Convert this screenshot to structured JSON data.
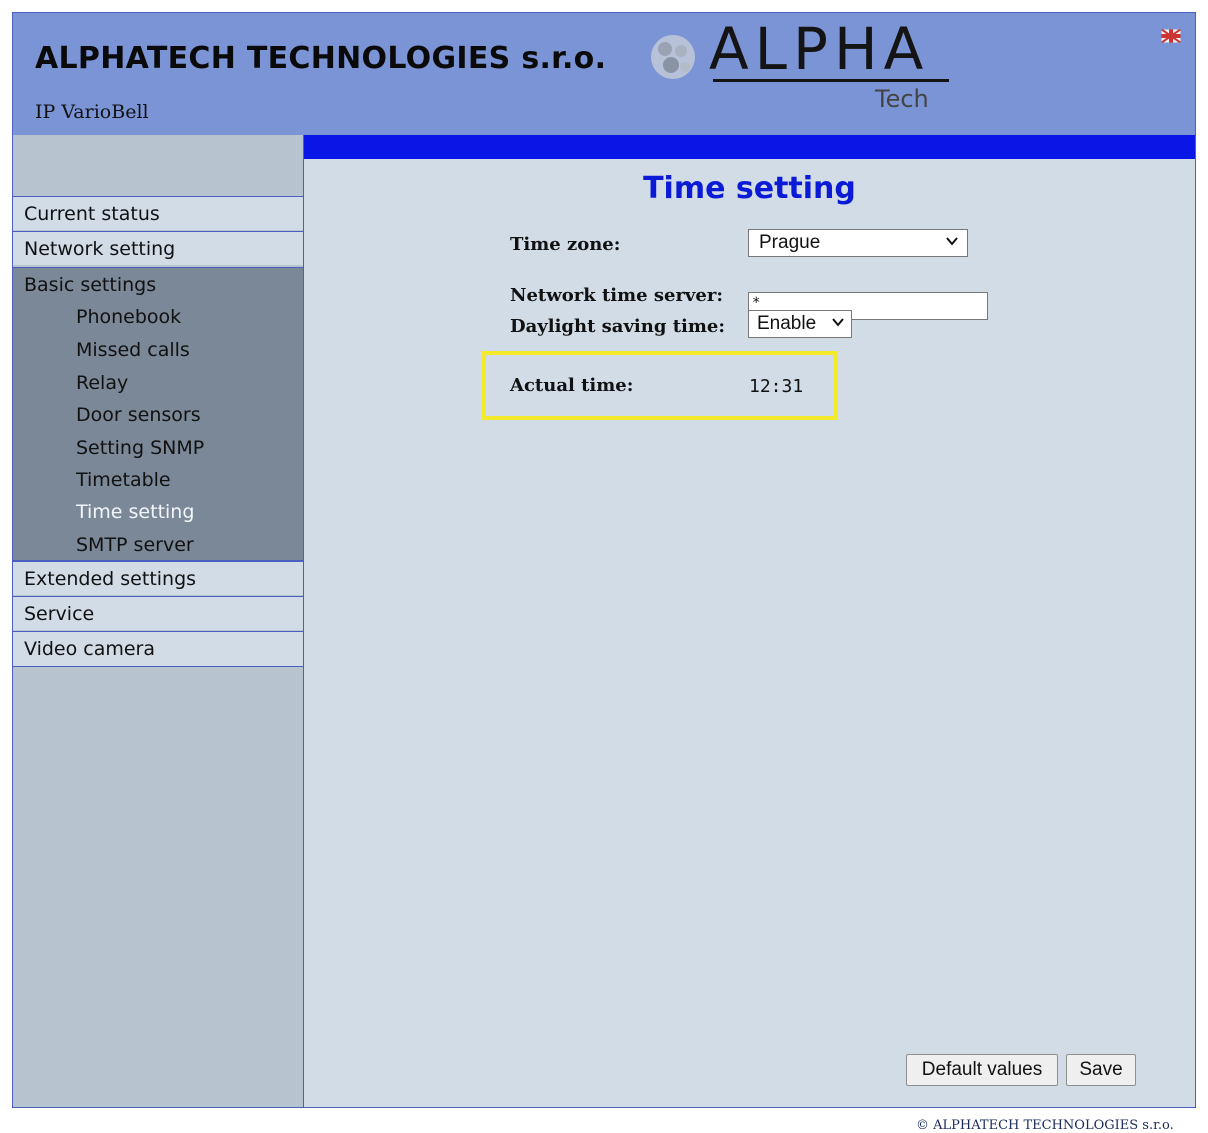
{
  "header": {
    "company": "ALPHATECH TECHNOLOGIES s.r.o.",
    "product": "IP VarioBell",
    "logo_text": "ALPHA",
    "logo_sub": "Tech",
    "language_flag": "uk-flag-icon"
  },
  "sidebar": {
    "items": [
      {
        "label": "Current status"
      },
      {
        "label": "Network setting"
      }
    ],
    "group": {
      "label": "Basic settings",
      "subitems": [
        {
          "label": "Phonebook"
        },
        {
          "label": "Missed calls"
        },
        {
          "label": "Relay"
        },
        {
          "label": "Door sensors"
        },
        {
          "label": "Setting SNMP"
        },
        {
          "label": "Timetable"
        },
        {
          "label": "Time setting",
          "active": true
        },
        {
          "label": "SMTP server"
        }
      ]
    },
    "after_items": [
      {
        "label": "Extended settings"
      },
      {
        "label": "Service"
      },
      {
        "label": "Video camera"
      }
    ]
  },
  "main": {
    "title": "Time setting",
    "time_zone": {
      "label": "Time zone:",
      "value": "Prague"
    },
    "ntp": {
      "label": "Network time server:",
      "value": "*"
    },
    "dst": {
      "label": "Daylight saving time:",
      "value": "Enable"
    },
    "actual_time": {
      "label": "Actual time:",
      "value": "12:31"
    },
    "buttons": {
      "defaults": "Default values",
      "save": "Save"
    }
  },
  "footer": {
    "copyright": "© ALPHATECH TECHNOLOGIES s.r.o."
  },
  "colors": {
    "header_bg": "#7b94d6",
    "accent_bar": "#0a16e6",
    "title": "#0a1ad6",
    "highlight": "#f2ea2a"
  }
}
